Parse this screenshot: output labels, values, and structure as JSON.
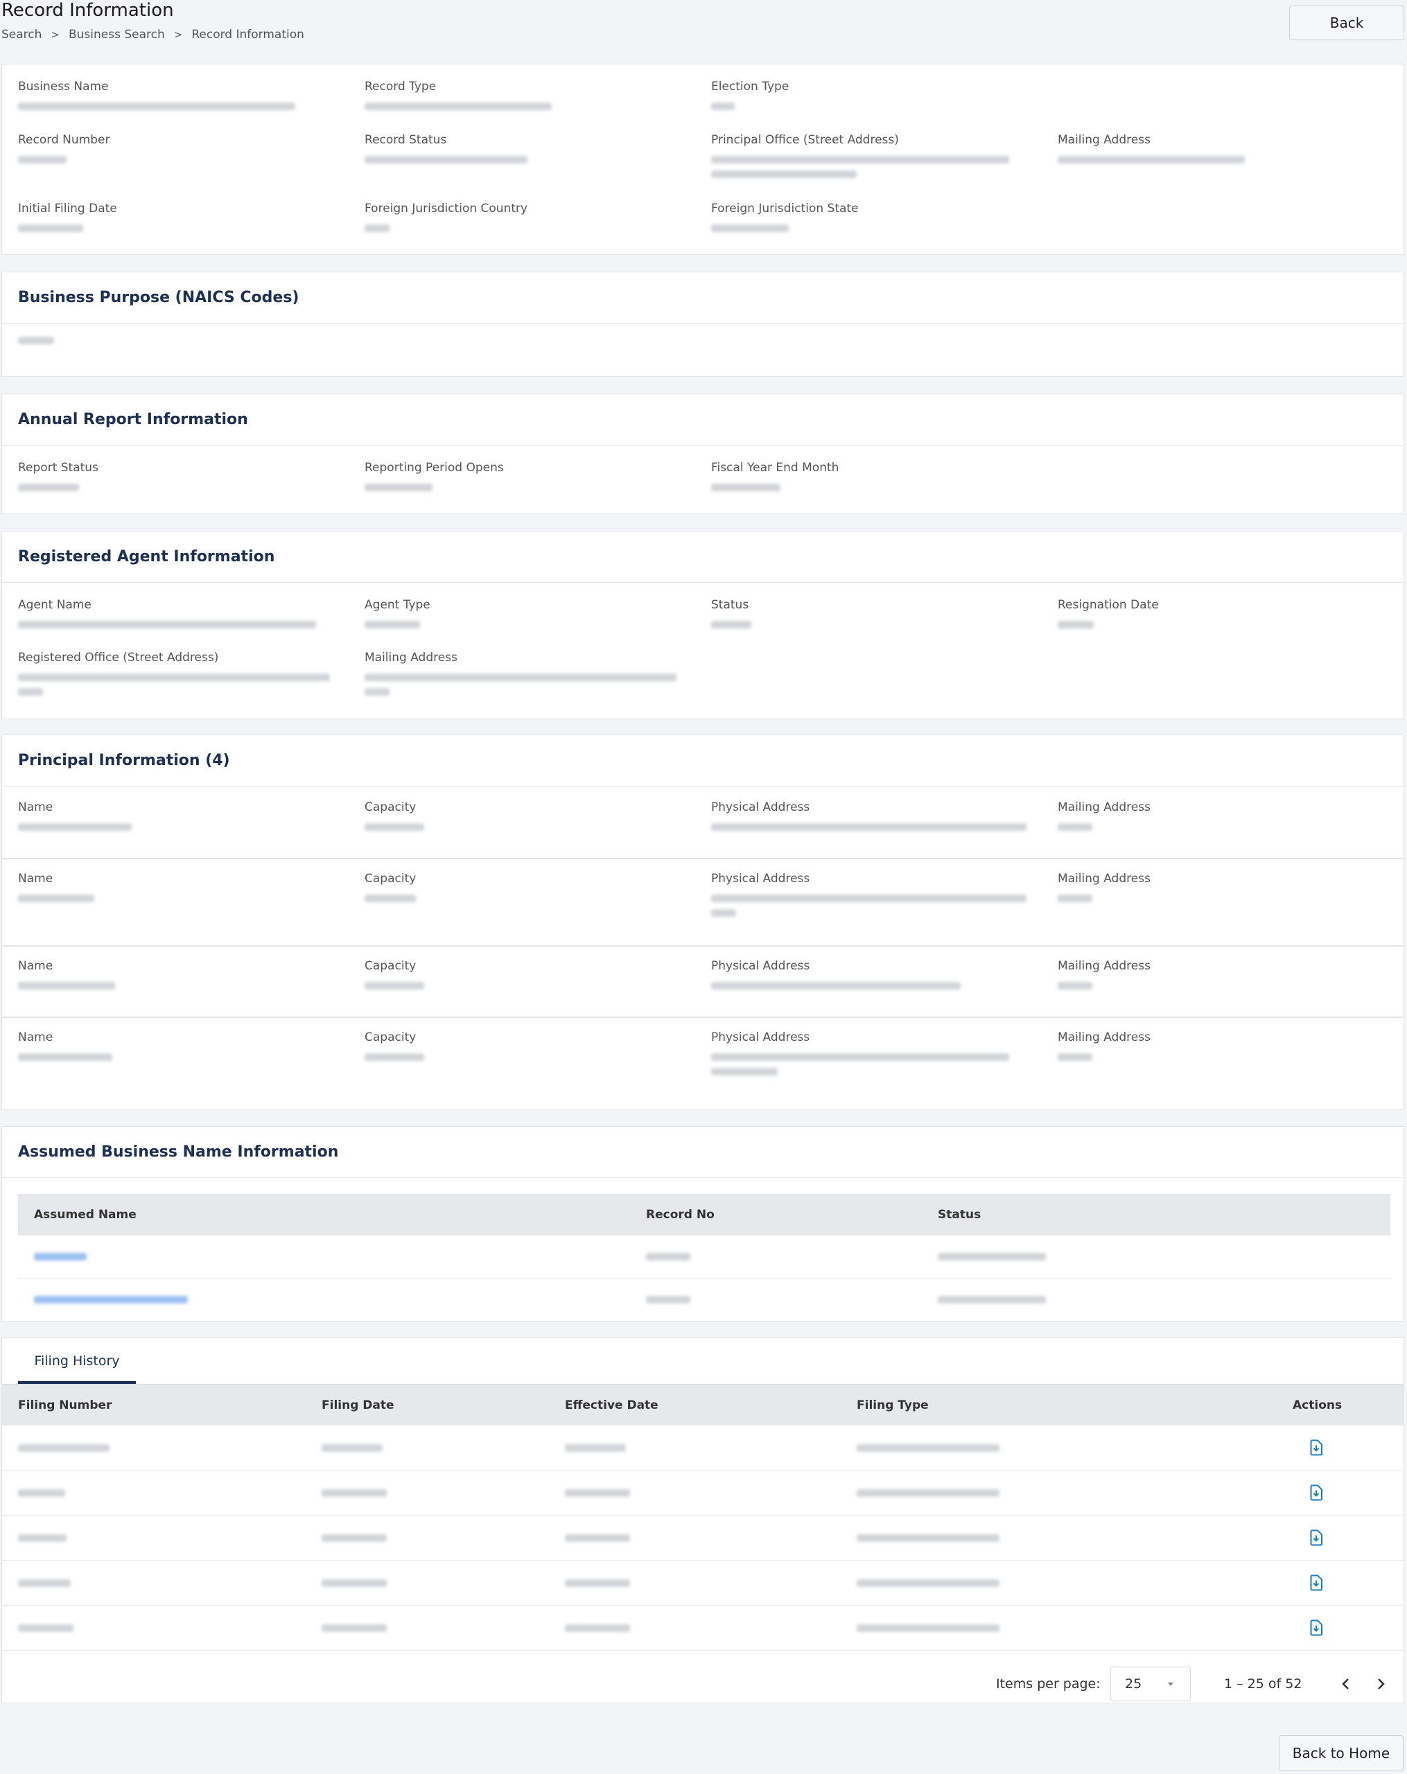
{
  "header": {
    "title": "Record Information",
    "back_label": "Back",
    "breadcrumb": [
      "Search",
      "Business Search",
      "Record Information"
    ],
    "breadcrumb_separator": ">"
  },
  "record": {
    "business_name_label": "Business Name",
    "record_type_label": "Record Type",
    "election_type_label": "Election Type",
    "record_number_label": "Record Number",
    "record_status_label": "Record Status",
    "principal_office_label": "Principal Office (Street Address)",
    "mailing_address_label": "Mailing Address",
    "initial_filing_date_label": "Initial Filing Date",
    "foreign_country_label": "Foreign Jurisdiction Country",
    "foreign_state_label": "Foreign Jurisdiction State"
  },
  "business_purpose": {
    "title": "Business Purpose (NAICS Codes)"
  },
  "annual_report": {
    "title": "Annual Report Information",
    "report_status_label": "Report Status",
    "reporting_period_label": "Reporting Period Opens",
    "fiscal_year_label": "Fiscal Year End Month"
  },
  "registered_agent": {
    "title": "Registered Agent Information",
    "agent_name_label": "Agent Name",
    "agent_type_label": "Agent Type",
    "status_label": "Status",
    "resignation_date_label": "Resignation Date",
    "registered_office_label": "Registered Office (Street Address)",
    "mailing_address_label": "Mailing Address"
  },
  "principals": {
    "title": "Principal Information (4)",
    "name_label": "Name",
    "capacity_label": "Capacity",
    "physical_address_label": "Physical Address",
    "mailing_address_label": "Mailing Address"
  },
  "assumed_names": {
    "title": "Assumed Business Name Information",
    "columns": [
      "Assumed Name",
      "Record No",
      "Status"
    ]
  },
  "filing_history": {
    "tab_label": "Filing History",
    "columns": [
      "Filing Number",
      "Filing Date",
      "Effective Date",
      "Filing Type",
      "Actions"
    ],
    "row_icon": "download-document-icon"
  },
  "pagination": {
    "items_per_page_label": "Items per page:",
    "items_per_page_value": "25",
    "range_label": "1 – 25 of 52"
  },
  "footer": {
    "back_home_label": "Back to Home"
  },
  "colors": {
    "heading": "#1e2f55",
    "icon": "#1a7fbf",
    "link": "#4a8ee6"
  }
}
